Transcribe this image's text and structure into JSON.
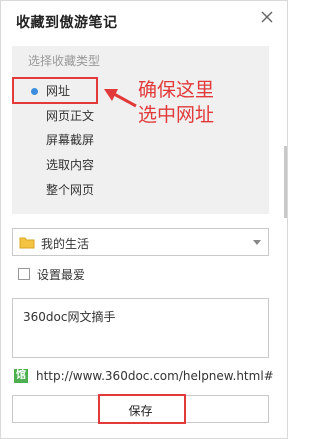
{
  "dialog": {
    "title": "收藏到傲游笔记"
  },
  "type_panel": {
    "header": "选择收藏类型",
    "items": [
      {
        "label": "网址",
        "selected": true
      },
      {
        "label": "网页正文",
        "selected": false
      },
      {
        "label": "屏幕截屏",
        "selected": false
      },
      {
        "label": "选取内容",
        "selected": false
      },
      {
        "label": "整个网页",
        "selected": false
      }
    ]
  },
  "annotation": {
    "line1": "确保这里",
    "line2": "选中网址",
    "color": "#e23a3a"
  },
  "folder_select": {
    "value": "我的生活"
  },
  "favorite": {
    "label": "设置最爱",
    "checked": false
  },
  "note": {
    "value": "360doc网文摘手"
  },
  "link": {
    "icon": "link-icon",
    "url": "http://www.360doc.com/helpnew.html#"
  },
  "actions": {
    "save_label": "保存"
  },
  "colors": {
    "accent": "#3c8dde",
    "highlight": "#e23a3a",
    "panel_bg": "#f0f0f0"
  }
}
